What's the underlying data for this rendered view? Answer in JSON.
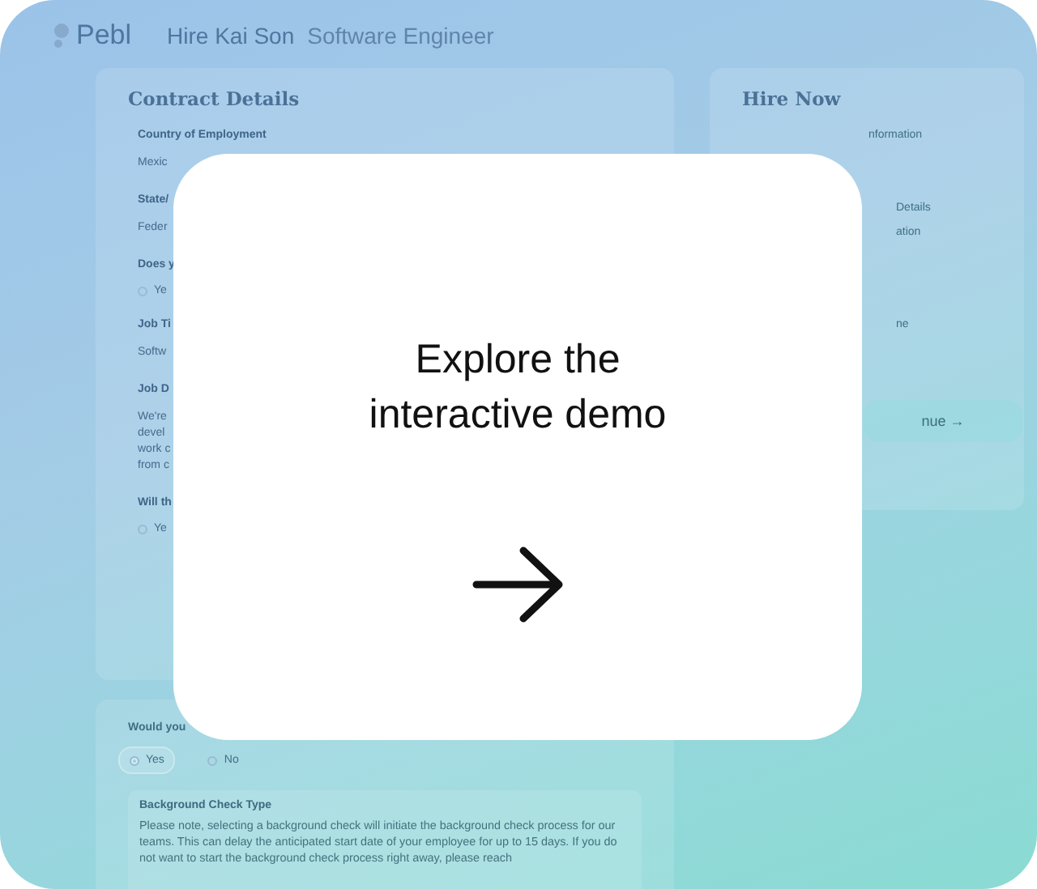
{
  "header": {
    "logo": "Pebl",
    "title": "Hire Kai Son",
    "subtitle": "Software Engineer"
  },
  "contract_panel": {
    "title": "Contract Details",
    "fields": [
      {
        "kind": "text",
        "label": "Country of Employment",
        "value": "Mexic"
      },
      {
        "kind": "text",
        "label": "State/",
        "value": "Feder"
      },
      {
        "kind": "radio",
        "label": "Does y",
        "options": [
          {
            "label": "Ye",
            "selected": false
          }
        ]
      },
      {
        "kind": "text",
        "label": "Job Ti",
        "value": "Softw"
      },
      {
        "kind": "paragraph",
        "label": "Job D",
        "lines": [
          "We're",
          "devel",
          "work c",
          "from c"
        ]
      },
      {
        "kind": "radio",
        "label": "Will th",
        "options": [
          {
            "label": "Ye",
            "selected": false
          }
        ]
      }
    ]
  },
  "hire_panel": {
    "title": "Hire Now",
    "steps": [
      "nformation",
      "Details",
      "ation",
      "ne"
    ],
    "button": "nue →"
  },
  "background_panel": {
    "question": "Would you",
    "options": [
      {
        "label": "Yes",
        "selected": true
      },
      {
        "label": "No",
        "selected": false
      }
    ],
    "box": {
      "title": "Background Check Type",
      "text": "Please note, selecting a background check will initiate the background check process for our teams. This can delay the anticipated start date of your employee for up to 15 days. If you do not want to start the background check process right away, please reach"
    }
  },
  "overlay": {
    "heading": "Explore the interactive demo"
  }
}
